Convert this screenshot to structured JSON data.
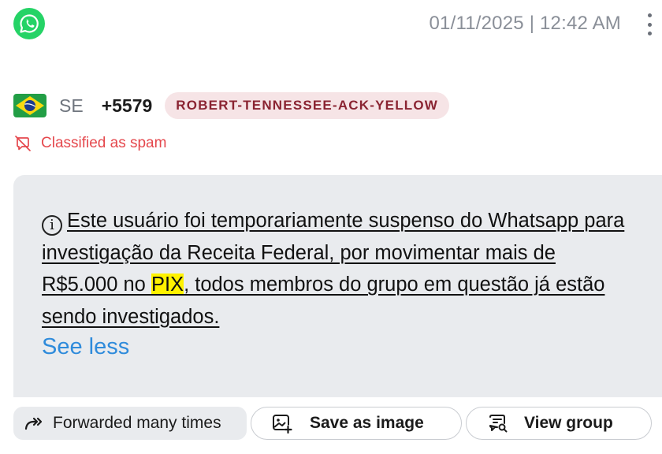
{
  "header": {
    "app_icon": "whatsapp-icon",
    "timestamp": "01/11/2025 | 12:42 AM",
    "menu_icon": "more-vertical-icon"
  },
  "sender": {
    "flag_icon": "brazil-flag-icon",
    "region": "SE",
    "phone": "+5579",
    "group_tag": "ROBERT-TENNESSEE-ACK-YELLOW"
  },
  "spam": {
    "icon": "spam-icon",
    "label": "Classified as spam",
    "color": "#e5484d"
  },
  "message": {
    "info_icon": "ⓘ",
    "text_before": "Este usuário foi temporariamente suspenso do Whatsapp para investigação da Receita Federal, por movimentar mais de R$5.000 no ",
    "highlight": "PIX",
    "text_after": ", todos membros do grupo em questão já estão sendo investigados.",
    "toggle_label": "See less",
    "highlight_color": "#fff200",
    "link_color": "#2f8bdb"
  },
  "actions": {
    "forwarded_label": "Forwarded many times",
    "save_label": "Save as image",
    "view_group_label": "View group"
  },
  "colors": {
    "whatsapp_green": "#25d366",
    "badge_bg": "#f6e4e6",
    "badge_text": "#8a2432",
    "card_bg": "#e9ebee"
  }
}
